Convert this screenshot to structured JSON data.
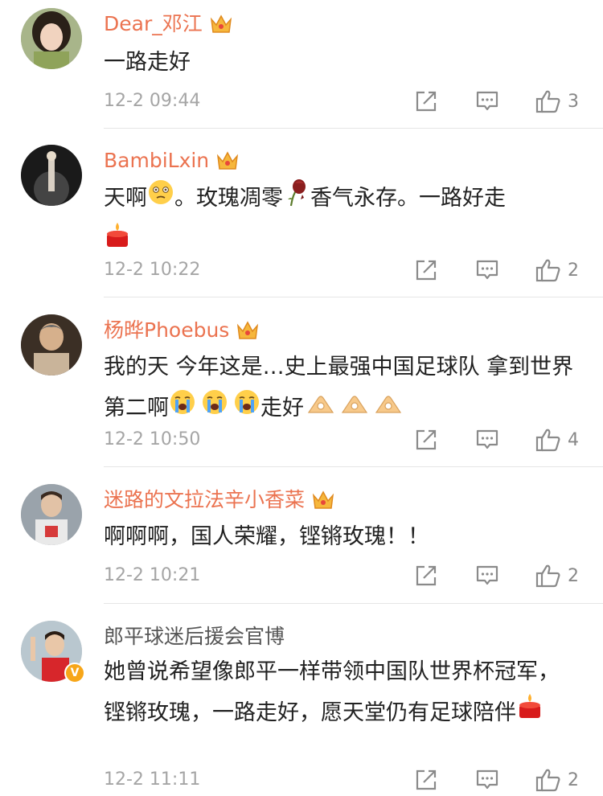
{
  "comments": [
    {
      "username": "Dear_邓江",
      "verified": "crown",
      "text_parts": [
        "一路走好"
      ],
      "time": "12-2 09:44",
      "likes": "3"
    },
    {
      "username": "BambiLxin",
      "verified": "crown",
      "text_parts": [
        "天啊",
        "。玫瑰凋零",
        "香气永存。一路好走"
      ],
      "time": "12-2 10:22",
      "likes": "2"
    },
    {
      "username": "杨晔Phoebus",
      "verified": "crown",
      "text_parts": [
        "我的天 今年这是…史上最强中国足球队 拿到世界第二啊",
        "走好"
      ],
      "time": "12-2 10:50",
      "likes": "4"
    },
    {
      "username": "迷路的文拉法辛小香菜",
      "verified": "crown",
      "text_parts": [
        "啊啊啊，国人荣耀，铿锵玫瑰！！"
      ],
      "time": "12-2 10:21",
      "likes": "2"
    },
    {
      "username": "郎平球迷后援会官博",
      "verified": "v-badge",
      "badge_label": "V",
      "text_parts": [
        "她曾说希望像郎平一样带领中国队世界杯冠军，铿锵玫瑰，一路走好，愿天堂仍有足球陪伴"
      ],
      "time": "12-2 11:11",
      "likes": "2"
    }
  ],
  "icons": {
    "share": "share-icon",
    "comment": "comment-icon",
    "like": "thumbs-up-icon",
    "crown": "crown-icon",
    "candle": "candle-emoji",
    "dizzy": "dizzy-face-emoji",
    "wilted_rose": "wilted-rose-emoji",
    "crying": "loudly-crying-emoji",
    "ok_hand": "ok-hand-emoji"
  },
  "colors": {
    "username": "#eb7350",
    "username_plain": "#555555",
    "text": "#222222",
    "meta": "#a5a5a5",
    "divider": "#e6e6e6",
    "badge": "#f7a619"
  }
}
